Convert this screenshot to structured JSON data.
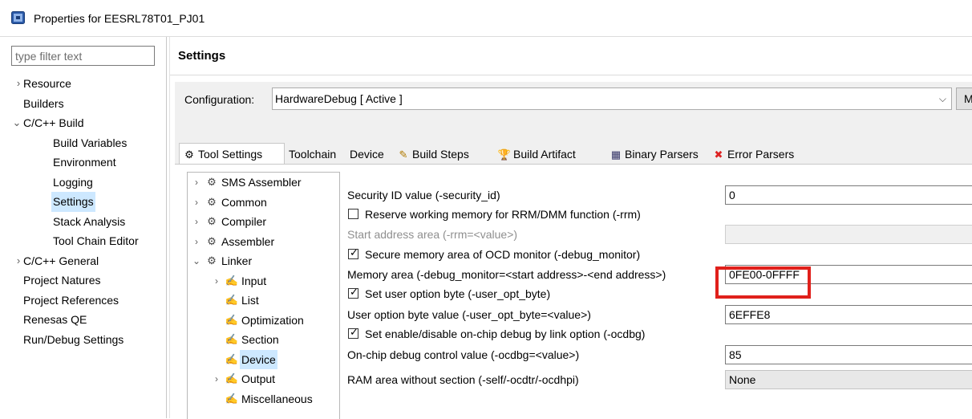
{
  "window": {
    "title": "Properties for EESRL78T01_PJ01"
  },
  "filter": {
    "placeholder": "type filter text"
  },
  "nav": {
    "items": [
      {
        "label": "Resource",
        "twisty": ">"
      },
      {
        "label": "Builders"
      },
      {
        "label": "C/C++ Build",
        "twisty": "v"
      },
      {
        "label": "Build Variables"
      },
      {
        "label": "Environment"
      },
      {
        "label": "Logging"
      },
      {
        "label": "Settings",
        "selected": true
      },
      {
        "label": "Stack Analysis"
      },
      {
        "label": "Tool Chain Editor"
      },
      {
        "label": "C/C++ General",
        "twisty": ">"
      },
      {
        "label": "Project Natures"
      },
      {
        "label": "Project References"
      },
      {
        "label": "Renesas QE"
      },
      {
        "label": "Run/Debug Settings"
      }
    ]
  },
  "settings": {
    "title": "Settings",
    "configuration_label": "Configuration:",
    "configuration_value": "HardwareDebug  [ Active ]",
    "manage_label": "Manage"
  },
  "tabs": [
    {
      "label": "Tool Settings",
      "icon": "tool-settings-icon",
      "active": true
    },
    {
      "label": "Toolchain"
    },
    {
      "label": "Device"
    },
    {
      "label": "Build Steps",
      "icon": "build-steps-icon"
    },
    {
      "label": "Build Artifact",
      "icon": "build-artifact-icon"
    },
    {
      "label": "Binary Parsers",
      "icon": "binary-parsers-icon"
    },
    {
      "label": "Error Parsers",
      "icon": "error-parsers-icon"
    }
  ],
  "tool_tree": [
    {
      "label": "SMS Assembler",
      "twisty": ">"
    },
    {
      "label": "Common",
      "twisty": ">"
    },
    {
      "label": "Compiler",
      "twisty": ">"
    },
    {
      "label": "Assembler",
      "twisty": ">"
    },
    {
      "label": "Linker",
      "twisty": "v"
    },
    {
      "label": "Input",
      "twisty": ">"
    },
    {
      "label": "List"
    },
    {
      "label": "Optimization"
    },
    {
      "label": "Section"
    },
    {
      "label": "Device",
      "selected": true
    },
    {
      "label": "Output",
      "twisty": ">"
    },
    {
      "label": "Miscellaneous"
    }
  ],
  "options": {
    "security_id_label": "Security ID value (-security_id)",
    "security_id_value": "0",
    "reserve_rrm_label": "Reserve working memory for RRM/DMM function (-rrm)",
    "reserve_rrm_checked": false,
    "start_address_label": "Start address area (-rrm=<value>)",
    "start_address_value": "",
    "secure_ocd_label": "Secure memory area of OCD monitor (-debug_monitor)",
    "secure_ocd_checked": true,
    "memory_area_label": "Memory area (-debug_monitor=<start address>-<end address>)",
    "memory_area_value": "0FE00-0FFFF",
    "set_user_opt_label": "Set user option byte (-user_opt_byte)",
    "set_user_opt_checked": true,
    "user_opt_value_label": "User option byte value (-user_opt_byte=<value>)",
    "user_opt_value": "6EFFE8",
    "set_ocdbg_label": "Set enable/disable on-chip debug by link option (-ocdbg)",
    "set_ocdbg_checked": true,
    "ocdbg_value_label": "On-chip debug control value (-ocdbg=<value>)",
    "ocdbg_value": "85",
    "ram_area_label": "RAM area without section (-self/-ocdtr/-ocdhpi)",
    "ram_area_value": "None"
  },
  "colors": {
    "highlight": "#e0201b",
    "selection": "#cde8ff",
    "panel": "#f0f0f0"
  }
}
